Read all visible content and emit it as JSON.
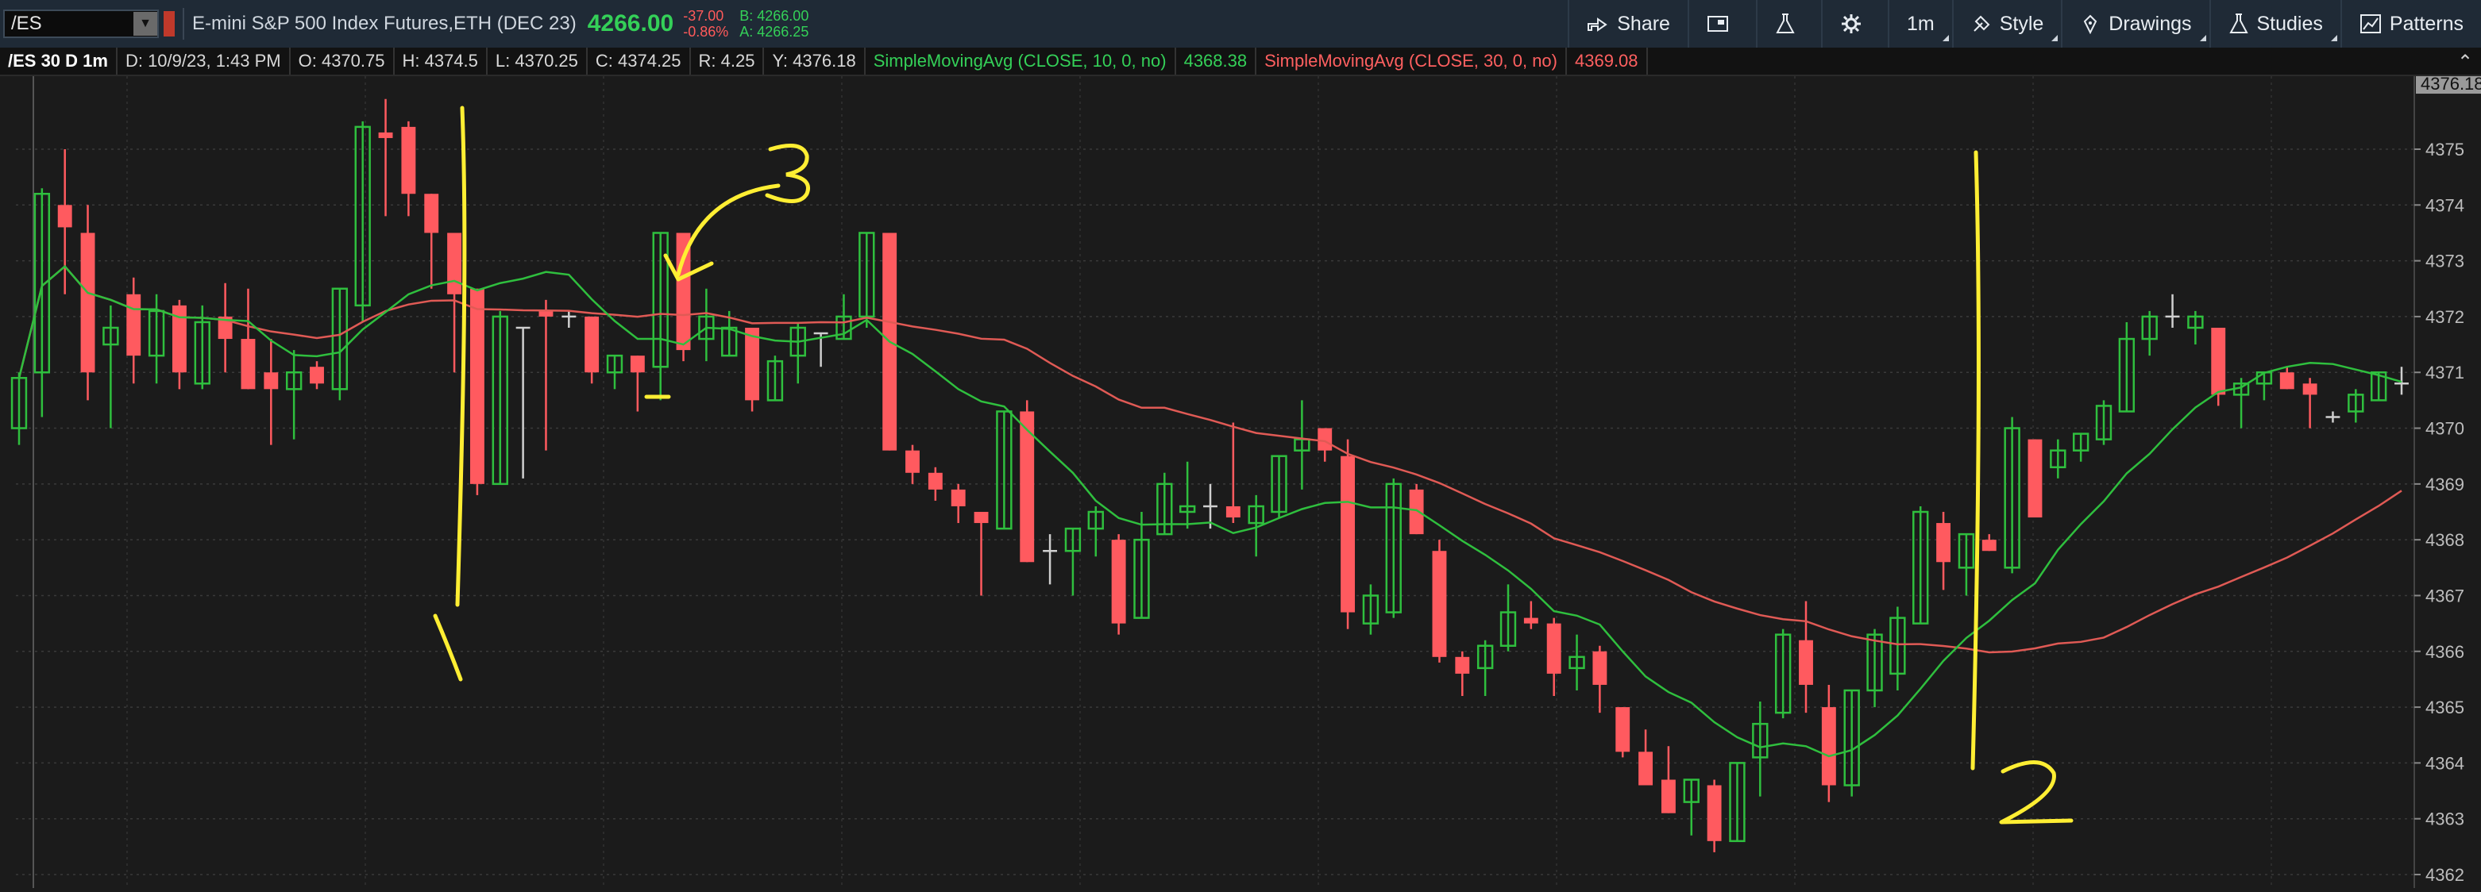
{
  "header": {
    "symbol": "/ES",
    "description": "E-mini S&P 500 Index Futures,ETH (DEC 23)",
    "last_price": "4266.00",
    "net_change": "-37.00",
    "pct_change": "-0.86%",
    "bid": "B: 4266.00",
    "ask": "A: 4266.25"
  },
  "toolbar": {
    "share": "Share",
    "timeframe": "1m",
    "style": "Style",
    "drawings": "Drawings",
    "studies": "Studies",
    "patterns": "Patterns"
  },
  "infobar": {
    "chart_symbol": "/ES 30 D 1m",
    "date": "D: 10/9/23, 1:43 PM",
    "open": "O: 4370.75",
    "high": "H: 4374.5",
    "low": "L: 4370.25",
    "close": "C: 4374.25",
    "range": "R: 4.25",
    "y": "Y: 4376.18",
    "sma_fast_label": "SimpleMovingAvg (CLOSE, 10, 0, no)",
    "sma_fast_value": "4368.38",
    "sma_slow_label": "SimpleMovingAvg (CLOSE, 30, 0, no)",
    "sma_slow_value": "4369.08"
  },
  "colors": {
    "up": "#2fbf3e",
    "down": "#ff5a5f",
    "sma_fast": "#2fbf3e",
    "sma_slow": "#e05a55",
    "annotation": "#ffee33"
  },
  "chart_data": {
    "type": "candlestick",
    "y_axis": {
      "min": 4362,
      "max": 4376,
      "ticks": [
        "4375",
        "4374",
        "4373",
        "4372",
        "4371",
        "4370",
        "4369",
        "4368",
        "4367",
        "4366",
        "4365",
        "4364",
        "4363",
        "4362"
      ]
    },
    "last_price_marker": "4376.18",
    "candles": [
      [
        4370.0,
        4371.0,
        4369.7,
        4370.9
      ],
      [
        4371.0,
        4374.3,
        4370.2,
        4374.2
      ],
      [
        4374.0,
        4375.0,
        4372.4,
        4373.6
      ],
      [
        4373.5,
        4374.0,
        4370.5,
        4371.0
      ],
      [
        4371.5,
        4372.2,
        4370.0,
        4371.8
      ],
      [
        4372.4,
        4372.7,
        4370.8,
        4371.3
      ],
      [
        4371.3,
        4372.4,
        4370.8,
        4372.1
      ],
      [
        4372.2,
        4372.3,
        4370.7,
        4371.0
      ],
      [
        4370.8,
        4372.2,
        4370.7,
        4371.9
      ],
      [
        4372.0,
        4372.6,
        4371.0,
        4371.6
      ],
      [
        4371.6,
        4372.5,
        4370.7,
        4370.7
      ],
      [
        4371.0,
        4371.6,
        4369.7,
        4370.7
      ],
      [
        4370.7,
        4371.4,
        4369.8,
        4371.0
      ],
      [
        4371.1,
        4371.2,
        4370.7,
        4370.8
      ],
      [
        4370.7,
        4372.5,
        4370.5,
        4372.5
      ],
      [
        4372.2,
        4375.5,
        4371.9,
        4375.4
      ],
      [
        4375.3,
        4375.9,
        4373.8,
        4375.2
      ],
      [
        4375.4,
        4375.5,
        4373.8,
        4374.2
      ],
      [
        4374.2,
        4374.2,
        4372.5,
        4373.5
      ],
      [
        4373.5,
        4373.5,
        4371.0,
        4372.4
      ],
      [
        4372.5,
        4372.5,
        4368.8,
        4369.0
      ],
      [
        4369.0,
        4372.1,
        4369.0,
        4372.0
      ],
      [
        4371.8,
        4371.7,
        4369.1,
        4371.8
      ],
      [
        4372.1,
        4372.3,
        4369.6,
        4372.0
      ],
      [
        4372.0,
        4372.1,
        4371.8,
        4372.0
      ],
      [
        4372.0,
        4372.0,
        4370.8,
        4371.0
      ],
      [
        4371.0,
        4371.3,
        4370.7,
        4371.3
      ],
      [
        4371.3,
        4371.3,
        4370.3,
        4371.0
      ],
      [
        4371.1,
        4373.5,
        4370.5,
        4373.5
      ],
      [
        4373.5,
        4373.5,
        4371.2,
        4371.4
      ],
      [
        4371.6,
        4372.5,
        4371.2,
        4372.0
      ],
      [
        4371.3,
        4372.1,
        4371.3,
        4371.8
      ],
      [
        4371.8,
        4371.8,
        4370.3,
        4370.5
      ],
      [
        4370.5,
        4371.3,
        4370.5,
        4371.2
      ],
      [
        4371.3,
        4371.9,
        4370.8,
        4371.8
      ],
      [
        4371.7,
        4371.6,
        4371.1,
        4371.7
      ],
      [
        4371.6,
        4372.4,
        4371.6,
        4372.0
      ],
      [
        4372.0,
        4373.5,
        4371.8,
        4373.5
      ],
      [
        4373.5,
        4373.5,
        4369.6,
        4369.6
      ],
      [
        4369.6,
        4369.7,
        4369.0,
        4369.2
      ],
      [
        4369.2,
        4369.3,
        4368.7,
        4368.9
      ],
      [
        4368.9,
        4369.0,
        4368.3,
        4368.6
      ],
      [
        4368.5,
        4368.5,
        4367.0,
        4368.3
      ],
      [
        4368.2,
        4370.3,
        4368.3,
        4370.3
      ],
      [
        4370.3,
        4370.5,
        4367.6,
        4367.6
      ],
      [
        4367.8,
        4368.1,
        4367.2,
        4367.8
      ],
      [
        4367.8,
        4368.2,
        4367.0,
        4368.2
      ],
      [
        4368.2,
        4368.6,
        4367.7,
        4368.5
      ],
      [
        4368.0,
        4368.1,
        4366.3,
        4366.5
      ],
      [
        4366.6,
        4368.5,
        4366.6,
        4368.0
      ],
      [
        4368.1,
        4369.2,
        4368.2,
        4369.0
      ],
      [
        4368.5,
        4369.4,
        4368.2,
        4368.6
      ],
      [
        4368.6,
        4369.0,
        4368.2,
        4368.6
      ],
      [
        4368.6,
        4370.1,
        4368.3,
        4368.4
      ],
      [
        4368.3,
        4368.8,
        4367.7,
        4368.6
      ],
      [
        4368.5,
        4369.5,
        4368.4,
        4369.5
      ],
      [
        4369.6,
        4370.5,
        4368.9,
        4369.8
      ],
      [
        4370.0,
        4370.0,
        4369.4,
        4369.6
      ],
      [
        4369.5,
        4369.8,
        4366.4,
        4366.7
      ],
      [
        4366.5,
        4367.2,
        4366.3,
        4367.0
      ],
      [
        4366.7,
        4369.1,
        4366.6,
        4369.0
      ],
      [
        4368.9,
        4369.0,
        4368.3,
        4368.1
      ],
      [
        4367.8,
        4368.0,
        4365.8,
        4365.9
      ],
      [
        4365.9,
        4366.0,
        4365.2,
        4365.6
      ],
      [
        4365.7,
        4366.2,
        4365.2,
        4366.1
      ],
      [
        4366.1,
        4367.2,
        4366.0,
        4366.7
      ],
      [
        4366.6,
        4366.9,
        4366.4,
        4366.5
      ],
      [
        4366.5,
        4366.6,
        4365.2,
        4365.6
      ],
      [
        4365.7,
        4366.3,
        4365.3,
        4365.9
      ],
      [
        4366.0,
        4366.1,
        4364.9,
        4365.4
      ],
      [
        4365.0,
        4364.9,
        4364.1,
        4364.2
      ],
      [
        4364.2,
        4364.6,
        4363.7,
        4363.6
      ],
      [
        4363.7,
        4364.3,
        4363.1,
        4363.1
      ],
      [
        4363.3,
        4363.6,
        4362.7,
        4363.7
      ],
      [
        4363.6,
        4363.7,
        4362.4,
        4362.6
      ],
      [
        4362.6,
        4363.9,
        4362.6,
        4364.0
      ],
      [
        4364.1,
        4365.1,
        4363.4,
        4364.7
      ],
      [
        4364.9,
        4366.4,
        4364.8,
        4366.3
      ],
      [
        4366.2,
        4366.9,
        4364.9,
        4365.4
      ],
      [
        4365.0,
        4365.4,
        4363.3,
        4363.6
      ],
      [
        4363.6,
        4363.3,
        4363.4,
        4365.3
      ],
      [
        4365.3,
        4366.4,
        4365.0,
        4366.3
      ],
      [
        4365.6,
        4366.8,
        4365.3,
        4366.6
      ],
      [
        4366.5,
        4368.6,
        4366.5,
        4368.5
      ],
      [
        4368.3,
        4368.5,
        4367.1,
        4367.6
      ],
      [
        4367.5,
        4368.1,
        4367.0,
        4368.1
      ],
      [
        4368.0,
        4368.1,
        4367.8,
        4367.8
      ],
      [
        4367.5,
        4370.2,
        4367.4,
        4370.0
      ],
      [
        4369.8,
        4369.3,
        4368.6,
        4368.4
      ],
      [
        4369.3,
        4369.8,
        4369.1,
        4369.6
      ],
      [
        4369.6,
        4369.9,
        4369.4,
        4369.9
      ],
      [
        4369.8,
        4370.5,
        4369.7,
        4370.4
      ],
      [
        4370.3,
        4371.9,
        4370.4,
        4371.6
      ],
      [
        4371.6,
        4372.1,
        4371.3,
        4372.0
      ],
      [
        4372.0,
        4372.4,
        4371.8,
        4372.0
      ],
      [
        4371.8,
        4372.1,
        4371.5,
        4372.0
      ],
      [
        4371.8,
        4371.8,
        4370.4,
        4370.6
      ],
      [
        4370.6,
        4370.9,
        4370.0,
        4370.8
      ],
      [
        4370.8,
        4371.0,
        4370.5,
        4371.0
      ],
      [
        4371.0,
        4371.1,
        4370.7,
        4370.7
      ],
      [
        4370.8,
        4370.9,
        4370.0,
        4370.6
      ],
      [
        4370.2,
        4370.3,
        4370.1,
        4370.2
      ],
      [
        4370.3,
        4370.7,
        4370.1,
        4370.6
      ],
      [
        4370.5,
        4371.0,
        4370.5,
        4371.0
      ],
      [
        4370.8,
        4371.1,
        4370.6,
        4370.8
      ]
    ],
    "annotations": [
      "1",
      "2",
      "3"
    ]
  }
}
